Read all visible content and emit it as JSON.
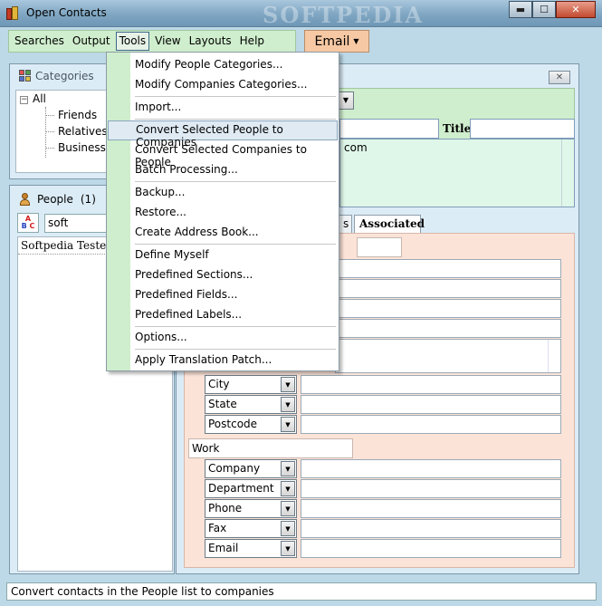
{
  "window": {
    "title": "Open Contacts",
    "watermark": "SOFTPEDIA",
    "minimize_glyph": "▬",
    "maximize_glyph": "☐",
    "close_glyph": "✕"
  },
  "menubar": {
    "items": [
      "Searches",
      "Output",
      "Tools",
      "View",
      "Layouts",
      "Help"
    ],
    "active": "Tools"
  },
  "email_button": {
    "label": "Email",
    "arrow": "▼"
  },
  "categories": {
    "title": "Categories",
    "toggle": "−",
    "root": "All",
    "children": [
      "Friends",
      "Relatives",
      "Business"
    ]
  },
  "people": {
    "title": "People",
    "count": "(1)",
    "sort_letters": [
      "A",
      "B",
      "C"
    ],
    "search_value": "soft",
    "rows": [
      "Softpedia Tester"
    ]
  },
  "detail": {
    "close_glyph": "✕",
    "title_label": "Title:",
    "email_fragment": "com",
    "tabs": [
      "s",
      "Associated"
    ],
    "section_work": "Work",
    "address_fields": [
      "City",
      "State",
      "Postcode"
    ],
    "work_fields": [
      "Company",
      "Department",
      "Phone",
      "Fax",
      "Email"
    ]
  },
  "tools_menu": {
    "groups": [
      [
        "Modify People Categories...",
        "Modify Companies Categories..."
      ],
      [
        "Import..."
      ],
      [
        "Convert Selected People to Companies",
        "Convert Selected Companies to People",
        "Batch Processing..."
      ],
      [
        "Backup...",
        "Restore...",
        "Create Address Book..."
      ],
      [
        "Define Myself",
        "Predefined Sections...",
        "Predefined Fields...",
        "Predefined Labels..."
      ],
      [
        "Options..."
      ],
      [
        "Apply Translation Patch..."
      ]
    ],
    "highlighted": "Convert Selected People to Companies"
  },
  "status": {
    "text": "Convert contacts in the People list to companies"
  }
}
